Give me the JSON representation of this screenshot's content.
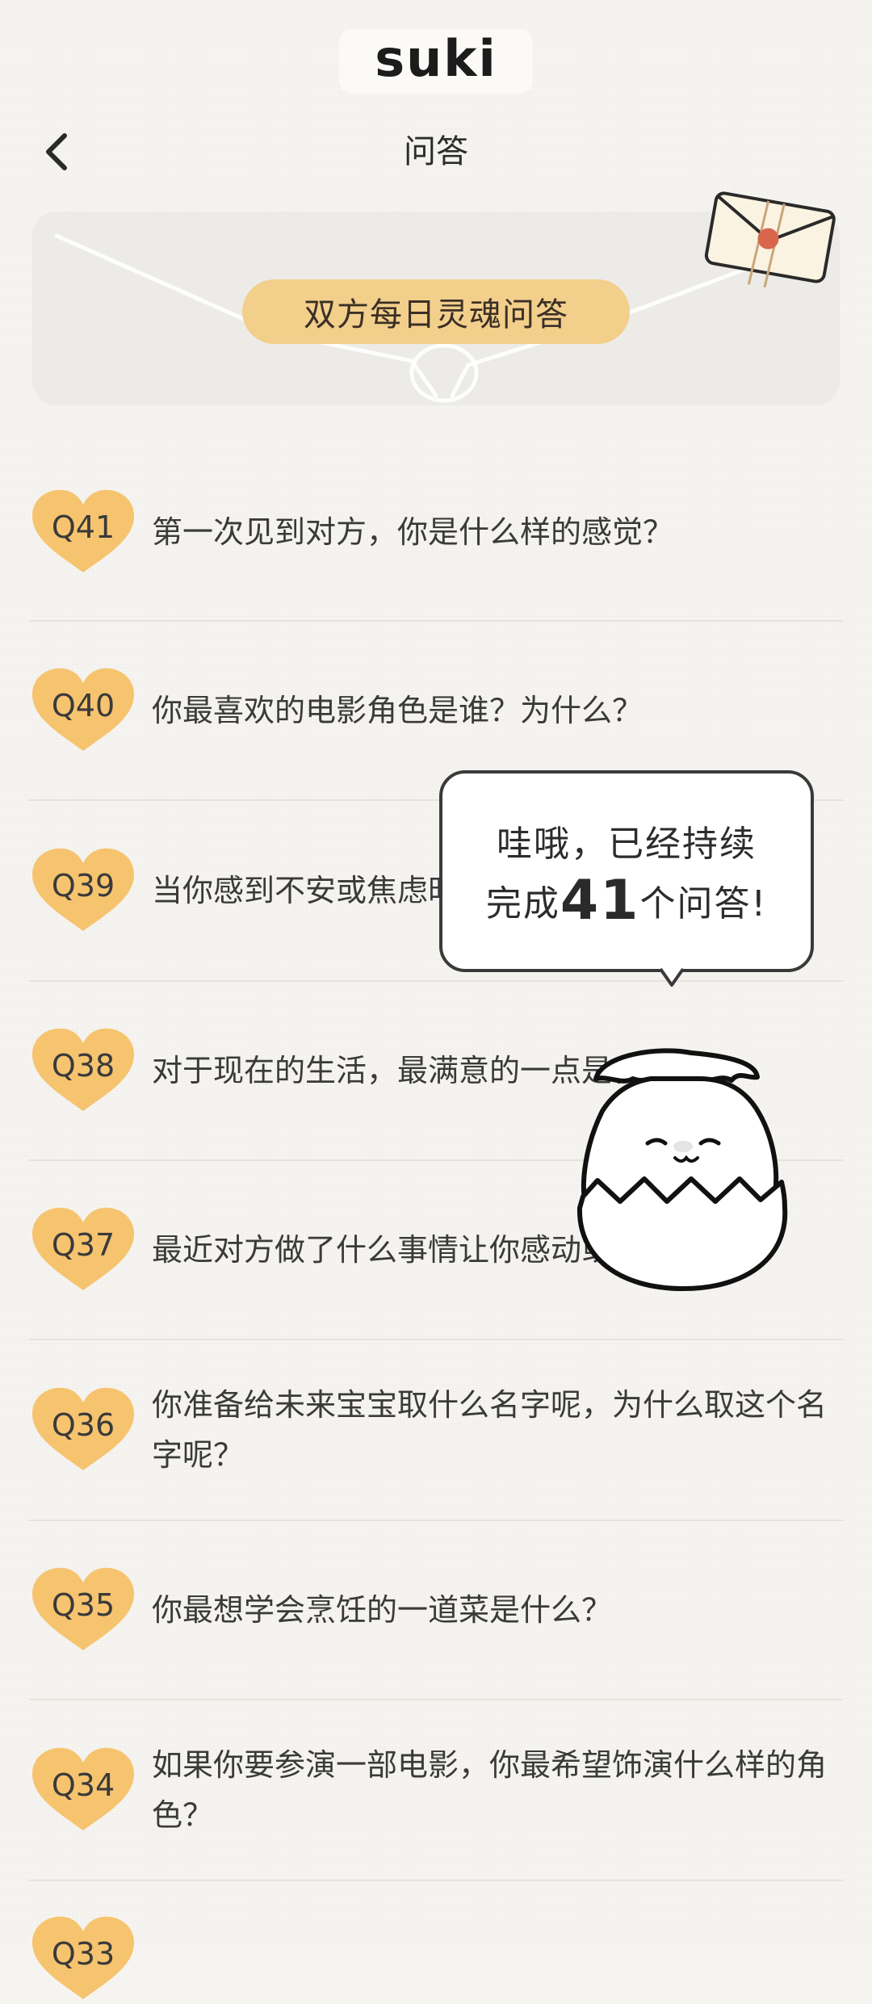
{
  "app": {
    "logo_text": "suki"
  },
  "header": {
    "title": "问答"
  },
  "banner": {
    "label": "双方每日灵魂问答"
  },
  "bubble": {
    "line1": "哇哦，已经持续",
    "line2_prefix": "完成",
    "count": "41",
    "line2_suffix": "个问答!"
  },
  "questions": [
    {
      "num": "Q41",
      "text": "第一次见到对方，你是什么样的感觉？"
    },
    {
      "num": "Q40",
      "text": "你最喜欢的电影角色是谁？为什么？"
    },
    {
      "num": "Q39",
      "text": "当你感到不安或焦虑时，你希望对方怎么安慰你？"
    },
    {
      "num": "Q38",
      "text": "对于现在的生活，最满意的一点是什么？"
    },
    {
      "num": "Q37",
      "text": "最近对方做了什么事情让你感动或开心？"
    },
    {
      "num": "Q36",
      "text": "你准备给未来宝宝取什么名字呢，为什么取这个名字呢？"
    },
    {
      "num": "Q35",
      "text": "你最想学会烹饪的一道菜是什么？"
    },
    {
      "num": "Q34",
      "text": "如果你要参演一部电影，你最希望饰演什么样的角色？"
    },
    {
      "num": "Q33",
      "text": ""
    }
  ],
  "colors": {
    "badge": "#f6c46f",
    "banner_pill": "#f3cf8c",
    "background": "#f6f4f0"
  }
}
